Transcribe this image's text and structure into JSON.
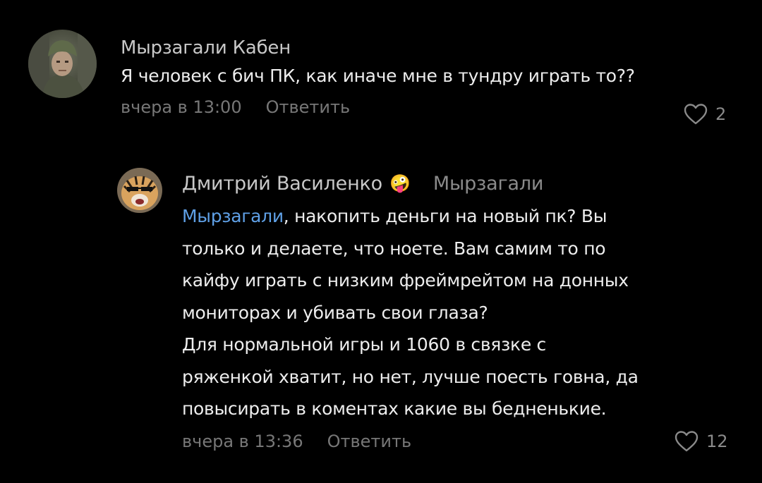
{
  "comments": [
    {
      "author": "Мырзагали Кабен",
      "text": "Я человек с бич ПК, как иначе мне в тундру играть то??",
      "time": "вчера в 13:00",
      "reply_label": "Ответить",
      "likes": "2"
    },
    {
      "author": "Дмитрий Василенко",
      "author_emoji": "🤪",
      "reply_to": "Мырзагали",
      "mention": "Мырзагали",
      "text_lines": [
        ", накопить деньги на новый пк?  Вы",
        "только и делаете, что ноете. Вам самим то по",
        "кайфу играть с низким фреймрейтом на донных",
        "мониторах и убивать свои глаза?",
        "Для нормальной игры и 1060 в связке с",
        "ряженкой хватит, но нет, лучше поесть говна, да",
        "повысирать в коментах какие вы бедненькие."
      ],
      "time": "вчера в 13:36",
      "reply_label": "Ответить",
      "likes": "12"
    }
  ],
  "colors": {
    "background": "#000000",
    "mention": "#5fa0e6",
    "meta": "#777777"
  },
  "icons": {
    "like": "heart-outline-icon"
  }
}
